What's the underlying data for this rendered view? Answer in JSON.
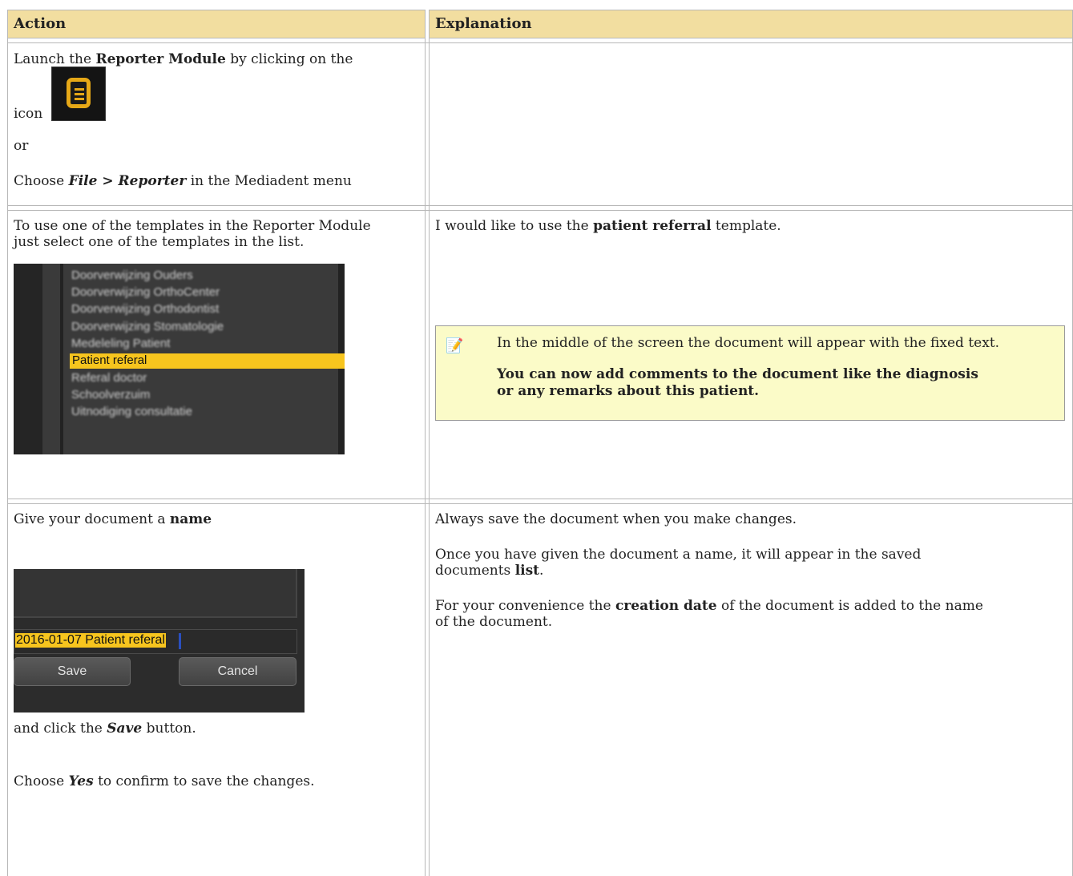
{
  "table": {
    "headers": {
      "action": "Action",
      "explanation": "Explanation"
    }
  },
  "rows": [
    {
      "action": {
        "launch_pre": "Launch the ",
        "launch_bold": "Reporter Module",
        "launch_post": " by clicking on the",
        "icon_label": "icon",
        "or": "or",
        "choose_pre": "Choose ",
        "choose_file": "File",
        "choose_sep": " > ",
        "choose_reporter": "Reporter",
        "choose_post": " in the Mediadent menu"
      }
    },
    {
      "action": {
        "line1": "To use one of the templates in the Reporter Module",
        "line2": "just select one of the templates in the list.",
        "template_list": {
          "blurred_items": [
            "Doorverwijzing Ouders",
            "Doorverwijzing OrthoCenter",
            "Doorverwijzing Orthodontist",
            "Doorverwijzing Stomatologie",
            "Medeleling Patient"
          ],
          "selected": "Patient referal",
          "blurred_items_after": [
            "Referal doctor",
            "Schoolverzuim",
            "Uitnodiging consultatie"
          ]
        }
      },
      "explanation": {
        "pre": "I would like to use the ",
        "bold": "patient referral",
        "post": " template.",
        "note_line": "In the middle of the screen the document will appear with the fixed text.",
        "note_bold_1": "You can now add comments to the document like the diagnosis",
        "note_bold_2": "or any remarks about this patient."
      }
    },
    {
      "action": {
        "give_pre": "Give your document a ",
        "give_bold": "name",
        "dialog": {
          "field_value": "2016-01-07 Patient referal",
          "save": "Save",
          "cancel": "Cancel"
        },
        "click_pre": "and click the ",
        "click_bold": "Save",
        "click_post": " button.",
        "confirm_pre": "Choose ",
        "confirm_bold": "Yes",
        "confirm_post": " to confirm to save the changes."
      },
      "explanation": {
        "line1": "Always save the document when you make changes.",
        "line2": "Once you have given the document a name, it will appear in the saved",
        "line3_pre": "documents ",
        "line3_bold": "list",
        "line3_post": ".",
        "line4_pre": "For your convenience the ",
        "line4_bold": "creation date",
        "line4_post": " of the document is added to the name",
        "line5": "of the document."
      }
    }
  ]
}
